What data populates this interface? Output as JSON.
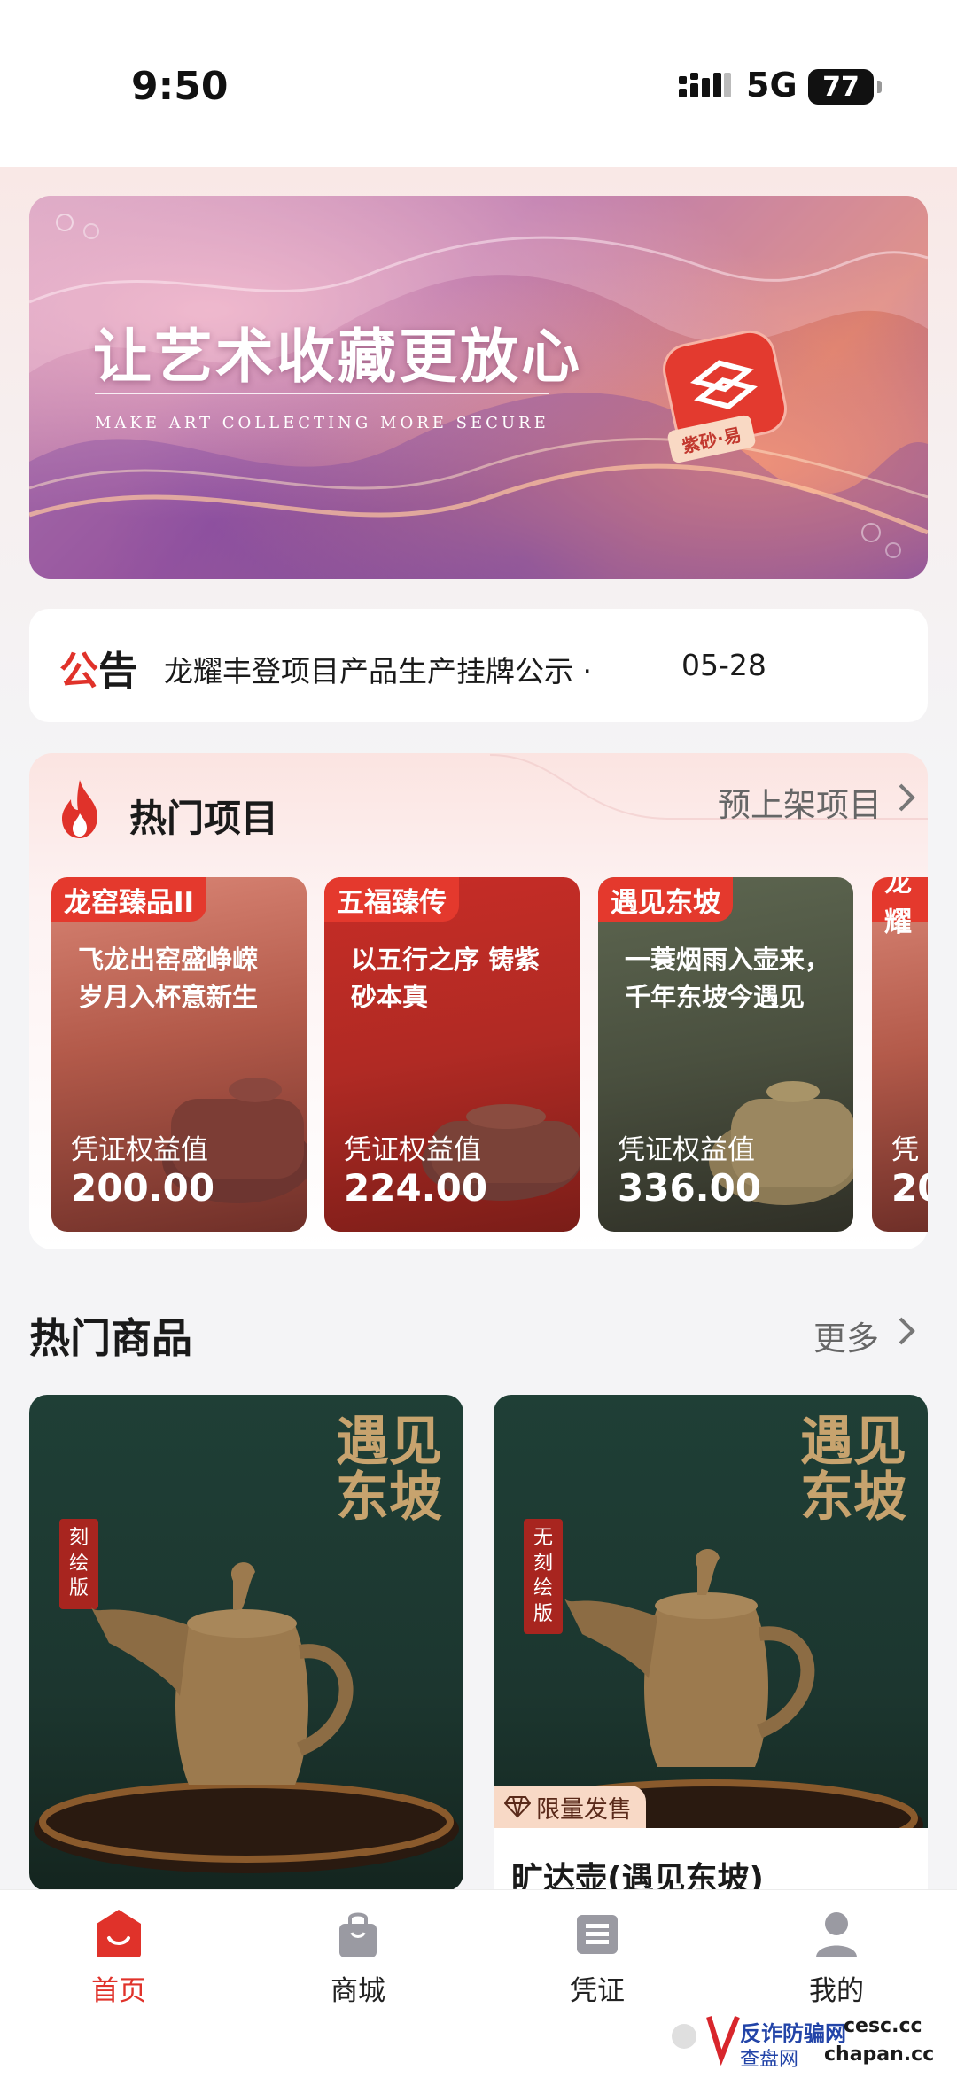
{
  "status": {
    "time": "9:50",
    "network": "5G",
    "battery": "77"
  },
  "banner": {
    "title": "让艺术收藏更放心",
    "subtitle": "MAKE ART COLLECTING MORE SECURE",
    "logo_text": "紫砂·易"
  },
  "notice": {
    "badge_a": "公",
    "badge_b": "告",
    "text": "龙耀丰登项目产品生产挂牌公示 ·",
    "date": "05-28"
  },
  "hot_projects": {
    "title": "热门项目",
    "more_label": "预上架项目",
    "items": [
      {
        "tag": "龙窑臻品II",
        "headline": "飞龙出窑盛峥嵘 岁月入杯意新生",
        "caption": "凭证权益值",
        "value": "200.00"
      },
      {
        "tag": "五福臻传",
        "headline": "以五行之序 铸紫砂本真",
        "caption": "凭证权益值",
        "value": "224.00"
      },
      {
        "tag": "遇见东坡",
        "headline": "一蓑烟雨入壶来， 千年东坡今遇见",
        "caption": "凭证权益值",
        "value": "336.00"
      },
      {
        "tag": "龙耀",
        "headline": "",
        "caption": "凭",
        "value": "20"
      }
    ]
  },
  "hot_goods": {
    "title": "热门商品",
    "more_label": "更多",
    "items": [
      {
        "vertical_text": "遇见东坡",
        "seal": "刻绘版"
      },
      {
        "vertical_text": "遇见东坡",
        "seal": "无刻绘版",
        "badge": "限量发售",
        "name": "旷达壶(遇见东坡)"
      }
    ]
  },
  "tabbar": {
    "items": [
      {
        "label": "首页",
        "icon": "home-icon",
        "active": true
      },
      {
        "label": "商城",
        "icon": "shopping-bag-icon",
        "active": false
      },
      {
        "label": "凭证",
        "icon": "certificate-icon",
        "active": false
      },
      {
        "label": "我的",
        "icon": "user-icon",
        "active": false
      }
    ]
  },
  "watermark": {
    "line1": "反诈防骗网",
    "line2": "查盘网",
    "line3": "cesc.cc",
    "line4": "chapan.cc"
  },
  "colors": {
    "accent": "#e0322a",
    "background": "#f4f4f6",
    "tag_red": "#e4392d"
  }
}
